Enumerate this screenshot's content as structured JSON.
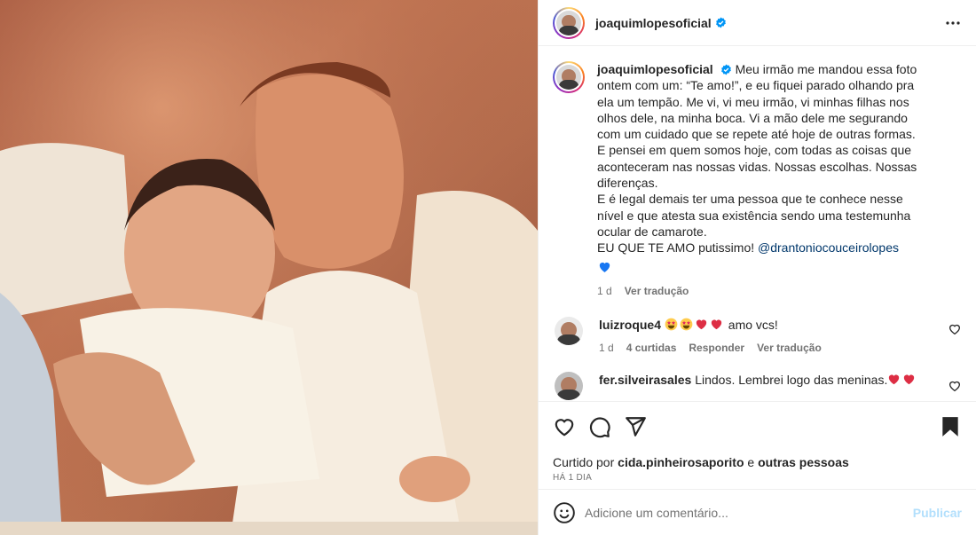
{
  "post": {
    "username": "joaquimlopesoficial",
    "verified": true,
    "more_icon": "more-horizontal-icon"
  },
  "caption": {
    "username": "joaquimlopesoficial",
    "lines": [
      "Meu irmão me mandou essa foto ontem com um: “Te amo!”, e eu fiquei parado olhando pra ela um tempão. Me vi, vi meu irmão, vi minhas filhas nos olhos dele, na minha boca. Vi a mão dele me segurando com um cuidado que se repete até hoje de outras formas.",
      "E pensei em quem somos hoje, com todas as coisas que aconteceram nas nossas vidas. Nossas escolhas. Nossas diferenças.",
      "E é legal demais ter uma pessoa que te conhece nesse nível e que atesta sua existência sendo uma testemunha ocular de camarote."
    ],
    "last_line_prefix": "EU QUE TE AMO putissimo!",
    "mention": "@drantoniocouceirolopes",
    "age": "1 d",
    "translate": "Ver tradução"
  },
  "comments": [
    {
      "username": "luizroque4",
      "text": "amo vcs!",
      "emojis": [
        "star-struck",
        "star-struck",
        "red-heart",
        "red-heart"
      ],
      "age": "1 d",
      "likes": "4 curtidas",
      "reply": "Responder",
      "translate": "Ver tradução"
    },
    {
      "username": "fer.silveirasales",
      "text": "Lindos. Lembrei logo das meninas.",
      "emojis": [
        "red-heart",
        "red-heart"
      ]
    }
  ],
  "actions": {
    "liked_by_prefix": "Curtido por",
    "liked_by_user": "cida.pinheirosaporito",
    "liked_by_suffix": "e",
    "liked_by_others": "outras pessoas",
    "timestamp": "HÁ 1 DIA"
  },
  "add_comment": {
    "placeholder": "Adicione um comentário...",
    "publish": "Publicar"
  },
  "colors": {
    "verified": "#0095f6",
    "link": "#00376b",
    "publish_disabled": "#b2dffc",
    "heart": "#ed4956"
  }
}
